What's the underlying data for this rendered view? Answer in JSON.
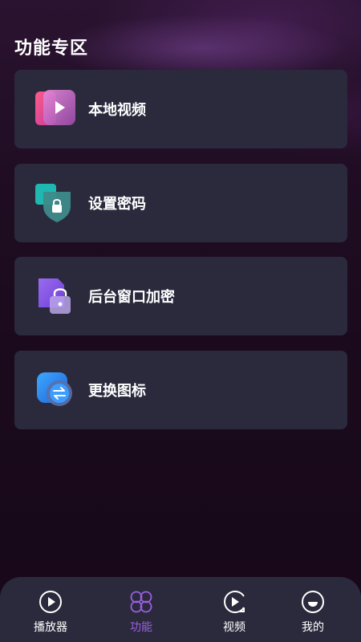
{
  "page": {
    "title": "功能专区"
  },
  "features": [
    {
      "label": "本地视频",
      "icon": "local-video-icon"
    },
    {
      "label": "设置密码",
      "icon": "set-password-icon"
    },
    {
      "label": "后台窗口加密",
      "icon": "background-window-lock-icon"
    },
    {
      "label": "更换图标",
      "icon": "change-icon-icon"
    }
  ],
  "tabbar": {
    "active_color": "#9b5fe0",
    "tabs": [
      {
        "label": "播放器",
        "icon": "play-circle-icon",
        "active": false
      },
      {
        "label": "功能",
        "icon": "clover-icon",
        "active": true
      },
      {
        "label": "视频",
        "icon": "video-circle-icon",
        "active": false
      },
      {
        "label": "我的",
        "icon": "profile-face-icon",
        "active": false
      }
    ]
  }
}
